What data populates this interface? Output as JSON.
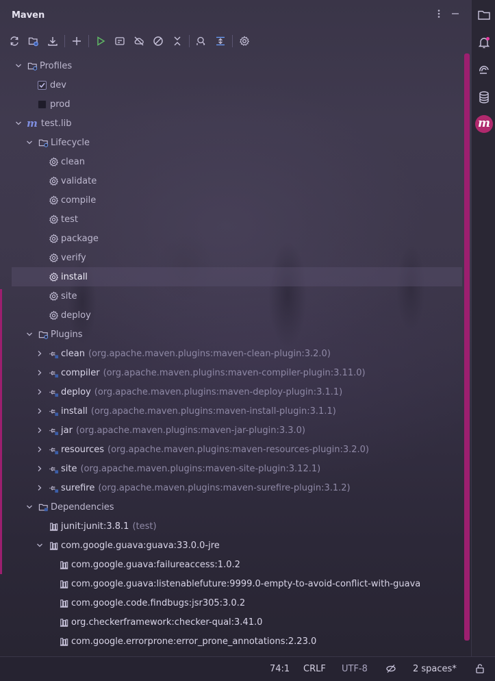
{
  "header": {
    "title": "Maven"
  },
  "toolbar": {
    "buttons": [
      "reload-icon",
      "generate-sources-icon",
      "download-icon",
      "add-icon",
      "run-icon",
      "execute-goal-icon",
      "offline-icon",
      "skip-tests-icon",
      "collapse-icon",
      "analyze-dependencies-icon",
      "show-dependencies-icon",
      "settings-icon"
    ]
  },
  "tree": {
    "profiles": {
      "label": "Profiles",
      "items": [
        {
          "label": "dev",
          "checked": true
        },
        {
          "label": "prod",
          "checked": false
        }
      ]
    },
    "project": {
      "label": "test.lib",
      "logo": "m"
    },
    "lifecycle": {
      "label": "Lifecycle",
      "items": [
        "clean",
        "validate",
        "compile",
        "test",
        "package",
        "verify",
        "install",
        "site",
        "deploy"
      ],
      "selected": "install"
    },
    "plugins": {
      "label": "Plugins",
      "items": [
        {
          "name": "clean",
          "coord": "(org.apache.maven.plugins:maven-clean-plugin:3.2.0)"
        },
        {
          "name": "compiler",
          "coord": "(org.apache.maven.plugins:maven-compiler-plugin:3.11.0)"
        },
        {
          "name": "deploy",
          "coord": "(org.apache.maven.plugins:maven-deploy-plugin:3.1.1)"
        },
        {
          "name": "install",
          "coord": "(org.apache.maven.plugins:maven-install-plugin:3.1.1)"
        },
        {
          "name": "jar",
          "coord": "(org.apache.maven.plugins:maven-jar-plugin:3.3.0)"
        },
        {
          "name": "resources",
          "coord": "(org.apache.maven.plugins:maven-resources-plugin:3.2.0)"
        },
        {
          "name": "site",
          "coord": "(org.apache.maven.plugins:maven-site-plugin:3.12.1)"
        },
        {
          "name": "surefire",
          "coord": "(org.apache.maven.plugins:maven-surefire-plugin:3.1.2)"
        }
      ]
    },
    "dependencies": {
      "label": "Dependencies",
      "junit": {
        "name": "junit:junit:3.8.1",
        "scope": "(test)"
      },
      "guava": {
        "name": "com.google.guava:guava:33.0.0-jre"
      },
      "guava_children": [
        "com.google.guava:failureaccess:1.0.2",
        "com.google.guava:listenablefuture:9999.0-empty-to-avoid-conflict-with-guava",
        "com.google.code.findbugs:jsr305:3.0.2",
        "org.checkerframework:checker-qual:3.41.0",
        "com.google.errorprone:error_prone_annotations:2.23.0"
      ]
    }
  },
  "rightbar": {
    "maven_badge": "m"
  },
  "status": {
    "position": "74:1",
    "line_ending": "CRLF",
    "encoding": "UTF-8",
    "indent": "2 spaces*"
  },
  "colors": {
    "accent": "#9c1f6f",
    "selection": "#58506c",
    "text": "#d9d5e8",
    "muted": "#8f89a6"
  }
}
